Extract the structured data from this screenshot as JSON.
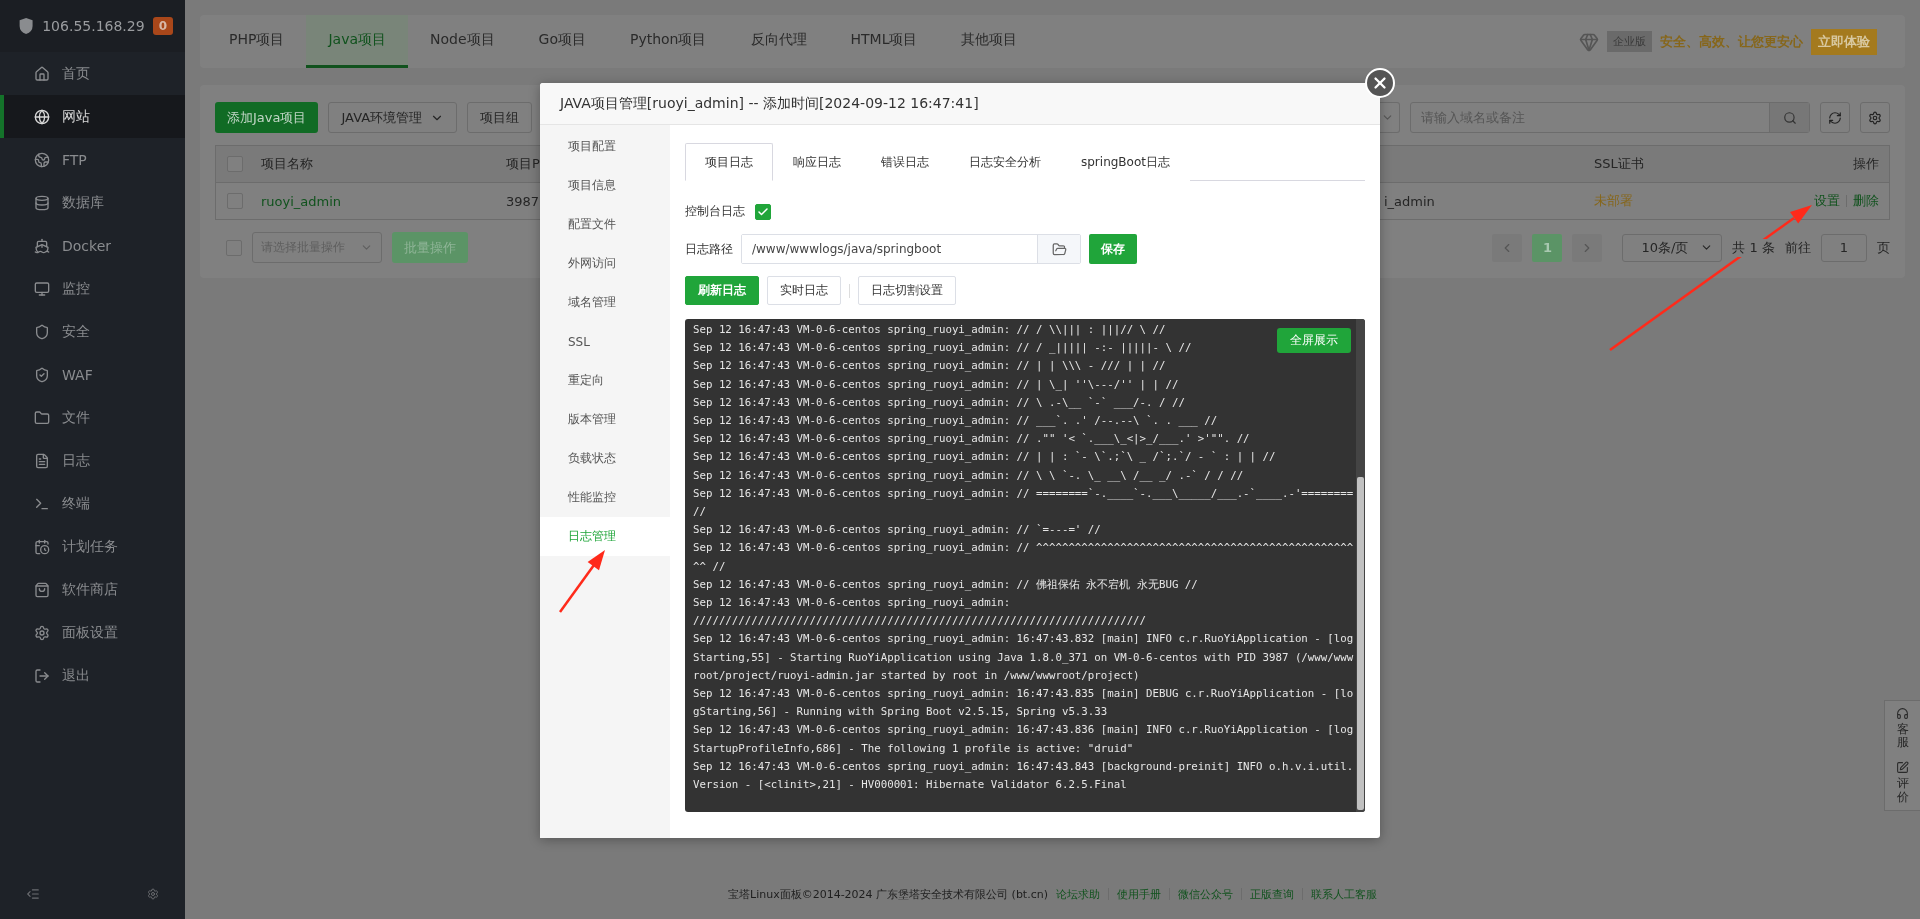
{
  "sidebar": {
    "host": "106.55.168.29",
    "badge": "0",
    "items": [
      {
        "label": "首页",
        "selected": false
      },
      {
        "label": "网站",
        "selected": true
      },
      {
        "label": "FTP",
        "selected": false
      },
      {
        "label": "数据库",
        "selected": false
      },
      {
        "label": "Docker",
        "selected": false
      },
      {
        "label": "监控",
        "selected": false
      },
      {
        "label": "安全",
        "selected": false
      },
      {
        "label": "WAF",
        "selected": false
      },
      {
        "label": "文件",
        "selected": false
      },
      {
        "label": "日志",
        "selected": false
      },
      {
        "label": "终端",
        "selected": false
      },
      {
        "label": "计划任务",
        "selected": false
      },
      {
        "label": "软件商店",
        "selected": false
      },
      {
        "label": "面板设置",
        "selected": false
      },
      {
        "label": "退出",
        "selected": false
      }
    ]
  },
  "project_tabs": [
    {
      "label": "PHP项目",
      "selected": false
    },
    {
      "label": "Java项目",
      "selected": true
    },
    {
      "label": "Node项目",
      "selected": false
    },
    {
      "label": "Go项目",
      "selected": false
    },
    {
      "label": "Python项目",
      "selected": false
    },
    {
      "label": "反向代理",
      "selected": false
    },
    {
      "label": "HTML项目",
      "selected": false
    },
    {
      "label": "其他项目",
      "selected": false
    }
  ],
  "promo": {
    "edition": "企业版",
    "slogan": "安全、高效、让您更安心",
    "button": "立即体验"
  },
  "toolbar": {
    "add_button": "添加Java项目",
    "env_button": "JAVA环境管理",
    "group_button": "项目组",
    "search": {
      "placeholder": "请输入域名或备注"
    }
  },
  "table": {
    "header_checked": false,
    "columns": [
      "项目名称",
      "项目P",
      "SSL证书",
      "操作"
    ],
    "rows": [
      {
        "checked": false,
        "name": "ruoyi_admin",
        "pid": "3987",
        "column_3": "i_admin",
        "ssl": "未部署",
        "actions": [
          "设置",
          "删除"
        ]
      }
    ]
  },
  "batch": {
    "checked": false,
    "placeholder": "请选择批量操作",
    "button": "批量操作"
  },
  "pagination": {
    "pages": [
      {
        "label": "1",
        "selected": true
      }
    ],
    "page_size": "10条/页",
    "total": "共 1 条",
    "goto_label": "前往",
    "goto_value": "1",
    "page_unit": "页"
  },
  "modal": {
    "title": "JAVA项目管理[ruoyi_admin] -- 添加时间[2024-09-12 16:47:41]",
    "menu": [
      {
        "label": "项目配置",
        "selected": false
      },
      {
        "label": "项目信息",
        "selected": false
      },
      {
        "label": "配置文件",
        "selected": false
      },
      {
        "label": "外网访问",
        "selected": false
      },
      {
        "label": "域名管理",
        "selected": false
      },
      {
        "label": "SSL",
        "selected": false
      },
      {
        "label": "重定向",
        "selected": false
      },
      {
        "label": "版本管理",
        "selected": false
      },
      {
        "label": "负载状态",
        "selected": false
      },
      {
        "label": "性能监控",
        "selected": false
      },
      {
        "label": "日志管理",
        "selected": true
      }
    ],
    "tabs": [
      {
        "label": "项目日志",
        "selected": true
      },
      {
        "label": "响应日志",
        "selected": false
      },
      {
        "label": "错误日志",
        "selected": false
      },
      {
        "label": "日志安全分析",
        "selected": false
      },
      {
        "label": "springBoot日志",
        "selected": false
      }
    ],
    "console_log": {
      "label": "控制台日志",
      "checked": true
    },
    "log_path": {
      "label": "日志路径",
      "value": "/www/wwwlogs/java/springboot"
    },
    "save_button": "保存",
    "actions": [
      {
        "label": "刷新日志",
        "kind": "primary"
      },
      {
        "label": "实时日志",
        "kind": "default"
      },
      {
        "label": "日志切割设置",
        "kind": "default"
      }
    ],
    "fullscreen_button": "全屏展示",
    "log_lines": [
      "Sep 12 16:47:43 VM-0-6-centos spring_ruoyi_admin: // / \\\\||| : |||// \\ //",
      "Sep 12 16:47:43 VM-0-6-centos spring_ruoyi_admin: // / _||||| -:- |||||- \\ //",
      "Sep 12 16:47:43 VM-0-6-centos spring_ruoyi_admin: // | | \\\\\\ - /// | | //",
      "Sep 12 16:47:43 VM-0-6-centos spring_ruoyi_admin: // | \\_| ''\\---/'' | | //",
      "Sep 12 16:47:43 VM-0-6-centos spring_ruoyi_admin: // \\ .-\\__ `-` ___/-. / //",
      "Sep 12 16:47:43 VM-0-6-centos spring_ruoyi_admin: // ___`. .' /--.--\\ `. . ___ //",
      "Sep 12 16:47:43 VM-0-6-centos spring_ruoyi_admin: // .\"\" '< `.___\\_<|>_/___.' >'\"\". //",
      "Sep 12 16:47:43 VM-0-6-centos spring_ruoyi_admin: // | | : `- \\`.;`\\ _ /`;.`/ - ` : | | //",
      "Sep 12 16:47:43 VM-0-6-centos spring_ruoyi_admin: // \\ \\ `-. \\_ __\\ /__ _/ .-` / / //",
      "Sep 12 16:47:43 VM-0-6-centos spring_ruoyi_admin: // ========`-.____`-.___\\_____/___.-`____.-'======== //",
      "Sep 12 16:47:43 VM-0-6-centos spring_ruoyi_admin: // `=---=' //",
      "Sep 12 16:47:43 VM-0-6-centos spring_ruoyi_admin: // ^^^^^^^^^^^^^^^^^^^^^^^^^^^^^^^^^^^^^^^^^^^^^^^^^^^ //",
      "Sep 12 16:47:43 VM-0-6-centos spring_ruoyi_admin: // 佛祖保佑 永不宕机 永无BUG //",
      "Sep 12 16:47:43 VM-0-6-centos spring_ruoyi_admin:",
      "//////////////////////////////////////////////////////////////////////",
      "Sep 12 16:47:43 VM-0-6-centos spring_ruoyi_admin: 16:47:43.832 [main] INFO c.r.RuoYiApplication - [logStarting,55] - Starting RuoYiApplication using Java 1.8.0_371 on VM-0-6-centos with PID 3987 (/www/wwwroot/project/ruoyi-admin.jar started by root in /www/wwwroot/project)",
      "Sep 12 16:47:43 VM-0-6-centos spring_ruoyi_admin: 16:47:43.835 [main] DEBUG c.r.RuoYiApplication - [logStarting,56] - Running with Spring Boot v2.5.15, Spring v5.3.33",
      "Sep 12 16:47:43 VM-0-6-centos spring_ruoyi_admin: 16:47:43.836 [main] INFO c.r.RuoYiApplication - [logStartupProfileInfo,686] - The following 1 profile is active: \"druid\"",
      "Sep 12 16:47:43 VM-0-6-centos spring_ruoyi_admin: 16:47:43.843 [background-preinit] INFO o.h.v.i.util.Version - [<clinit>,21] - HV000001: Hibernate Validator 6.2.5.Final"
    ]
  },
  "footer": {
    "text": "宝塔Linux面板©2014-2024 广东堡塔安全技术有限公司 (bt.cn)",
    "links": [
      "论坛求助",
      "使用手册",
      "微信公众号",
      "正版查询",
      "联系人工客服"
    ]
  },
  "side_widget": [
    "客服",
    "评价"
  ]
}
